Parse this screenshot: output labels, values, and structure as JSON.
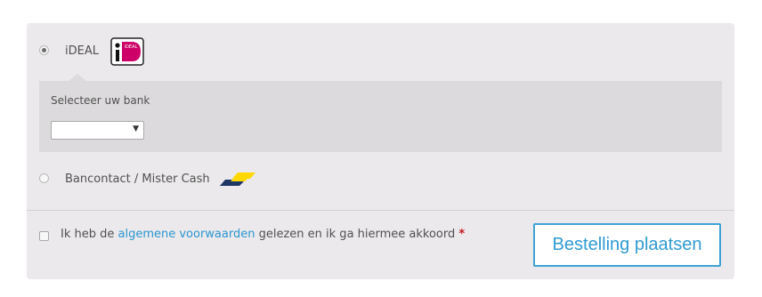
{
  "payment_methods": [
    {
      "label": "iDEAL",
      "logo": "ideal-logo",
      "selected": true
    },
    {
      "label": "Bancontact / Mister Cash",
      "logo": "bancontact-logo",
      "selected": false
    }
  ],
  "ideal_logo_text": "iDEAL",
  "bank_select": {
    "label": "Selecteer uw bank",
    "value": ""
  },
  "terms": {
    "prefix": "Ik heb de ",
    "link_text": "algemene voorwaarden",
    "suffix": " gelezen en ik ga hiermee akkoord ",
    "required_mark": "*"
  },
  "place_order_label": "Bestelling plaatsen",
  "colors": {
    "panel_bg": "#ebe9eb",
    "bank_box_bg": "#dcdadc",
    "link": "#2a96d1",
    "button_border": "#3ea2d6",
    "required": "#c4191c"
  }
}
